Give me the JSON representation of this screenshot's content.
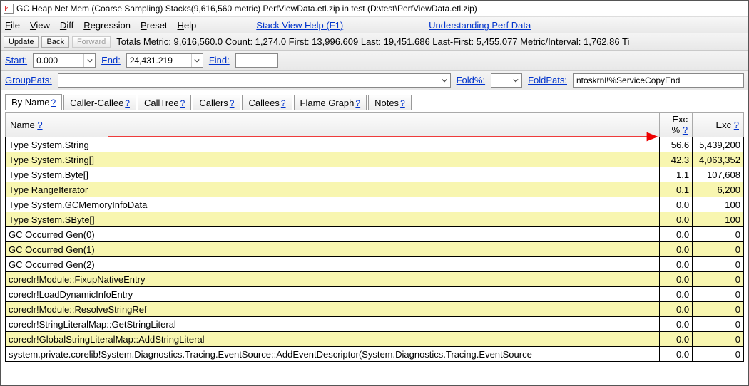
{
  "title": "GC Heap Net Mem (Coarse Sampling) Stacks(9,616,560 metric) PerfViewData.etl.zip in test (D:\\test\\PerfViewData.etl.zip)",
  "menu": {
    "file": "File",
    "view": "View",
    "diff": "Diff",
    "regression": "Regression",
    "preset": "Preset",
    "help": "Help",
    "help_link": "Stack View Help (F1)",
    "perf_link": "Understanding Perf Data"
  },
  "nav": {
    "update": "Update",
    "back": "Back",
    "forward": "Forward",
    "totals": "Totals Metric: 9,616,560.0  Count: 1,274.0  First: 13,996.609 Last: 19,451.686  Last-First: 5,455.077  Metric/Interval: 1,762.86  Ti"
  },
  "filter1": {
    "start_label": "Start:",
    "start_value": "0.000",
    "end_label": "End:",
    "end_value": "24,431.219",
    "find_label": "Find:",
    "find_value": ""
  },
  "filter2": {
    "grouppats_label": "GroupPats:",
    "grouppats_value": "",
    "foldpct_label": "Fold%:",
    "foldpct_value": "",
    "foldpats_label": "FoldPats:",
    "foldpats_value": "ntoskrnl!%ServiceCopyEnd"
  },
  "tabs": {
    "byname": "By Name",
    "callercallee": "Caller-Callee",
    "calltree": "CallTree",
    "callers": "Callers",
    "callees": "Callees",
    "flame": "Flame Graph",
    "notes": "Notes",
    "q": "?"
  },
  "headers": {
    "name": "Name",
    "excpct": "Exc %",
    "exc": "Exc",
    "q": "?"
  },
  "rows": [
    {
      "name": "Type System.String",
      "pct": "56.6",
      "exc": "5,439,200",
      "hl": false,
      "arrow": true
    },
    {
      "name": "Type System.String[]",
      "pct": "42.3",
      "exc": "4,063,352",
      "hl": true
    },
    {
      "name": "Type System.Byte[]",
      "pct": "1.1",
      "exc": "107,608",
      "hl": false
    },
    {
      "name": "Type RangeIterator",
      "pct": "0.1",
      "exc": "6,200",
      "hl": true
    },
    {
      "name": "Type System.GCMemoryInfoData",
      "pct": "0.0",
      "exc": "100",
      "hl": false
    },
    {
      "name": "Type System.SByte[]",
      "pct": "0.0",
      "exc": "100",
      "hl": true
    },
    {
      "name": "GC Occurred Gen(0)",
      "pct": "0.0",
      "exc": "0",
      "hl": false
    },
    {
      "name": "GC Occurred Gen(1)",
      "pct": "0.0",
      "exc": "0",
      "hl": true
    },
    {
      "name": "GC Occurred Gen(2)",
      "pct": "0.0",
      "exc": "0",
      "hl": false
    },
    {
      "name": "coreclr!Module::FixupNativeEntry",
      "pct": "0.0",
      "exc": "0",
      "hl": true
    },
    {
      "name": "coreclr!LoadDynamicInfoEntry",
      "pct": "0.0",
      "exc": "0",
      "hl": false
    },
    {
      "name": "coreclr!Module::ResolveStringRef",
      "pct": "0.0",
      "exc": "0",
      "hl": true
    },
    {
      "name": "coreclr!StringLiteralMap::GetStringLiteral",
      "pct": "0.0",
      "exc": "0",
      "hl": false
    },
    {
      "name": "coreclr!GlobalStringLiteralMap::AddStringLiteral",
      "pct": "0.0",
      "exc": "0",
      "hl": true
    },
    {
      "name": "system.private.corelib!System.Diagnostics.Tracing.EventSource::AddEventDescriptor(System.Diagnostics.Tracing.EventSource",
      "pct": "0.0",
      "exc": "0",
      "hl": false
    }
  ]
}
